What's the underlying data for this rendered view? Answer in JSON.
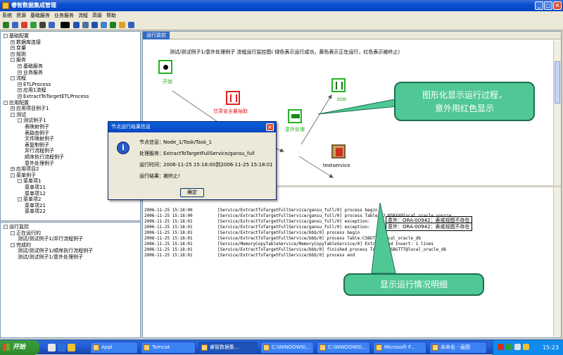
{
  "window": {
    "title": "睿智数据集成管理"
  },
  "menu": [
    "系统",
    "资源",
    "基础服务",
    "业务服务",
    "流程",
    "高级",
    "帮助"
  ],
  "tree_top": [
    {
      "label": "基础配置",
      "level": 0,
      "expander": "-"
    },
    {
      "label": "数据库连接",
      "level": 1,
      "expander": "+"
    },
    {
      "label": "变量",
      "level": 1,
      "expander": "+"
    },
    {
      "label": "规则",
      "level": 1,
      "expander": "+"
    },
    {
      "label": "服务",
      "level": 1,
      "expander": "-"
    },
    {
      "label": "基础服务",
      "level": 2,
      "expander": "+"
    },
    {
      "label": "业务服务",
      "level": 2,
      "expander": "+"
    },
    {
      "label": "流程",
      "level": 1,
      "expander": "-"
    },
    {
      "label": "ETLProcess",
      "level": 2,
      "expander": "+"
    },
    {
      "label": "应用1流程",
      "level": 2,
      "expander": "+"
    },
    {
      "label": "ExtractToTargetETLProcess",
      "level": 2,
      "expander": "+"
    },
    {
      "label": "应用配置",
      "level": 0,
      "expander": "-"
    },
    {
      "label": "应用项目例子1",
      "level": 1,
      "expander": "+"
    },
    {
      "label": "测试",
      "level": 1,
      "expander": "-"
    },
    {
      "label": "测试例子1",
      "level": 2,
      "expander": "-"
    },
    {
      "label": "表映射例子",
      "level": 3,
      "expander": ""
    },
    {
      "label": "表路由例子",
      "level": 3,
      "expander": ""
    },
    {
      "label": "文件映射例子",
      "level": 3,
      "expander": ""
    },
    {
      "label": "表复制例子",
      "level": 3,
      "expander": ""
    },
    {
      "label": "并行流程例子",
      "level": 3,
      "expander": ""
    },
    {
      "label": "顺序执行流程例子",
      "level": 3,
      "expander": ""
    },
    {
      "label": "意外处理例子",
      "level": 3,
      "expander": ""
    },
    {
      "label": "应用项目2",
      "level": 1,
      "expander": "+"
    },
    {
      "label": "菜单例子",
      "level": 1,
      "expander": "-"
    },
    {
      "label": "菜单项1",
      "level": 2,
      "expander": "-"
    },
    {
      "label": "菜单项11",
      "level": 3,
      "expander": ""
    },
    {
      "label": "菜单项12",
      "level": 3,
      "expander": ""
    },
    {
      "label": "菜单项2",
      "level": 2,
      "expander": "-"
    },
    {
      "label": "菜单项21",
      "level": 3,
      "expander": ""
    },
    {
      "label": "菜单项22",
      "level": 3,
      "expander": ""
    }
  ],
  "tree_bottom": [
    {
      "label": "运行监控",
      "level": 0,
      "expander": "-"
    },
    {
      "label": "正在运行的",
      "level": 1,
      "expander": "-"
    },
    {
      "label": "测试/测试例子1/并行流程例子",
      "level": 2,
      "expander": ""
    },
    {
      "label": "完成的",
      "level": 1,
      "expander": "-"
    },
    {
      "label": "测试/测试例子1/顺序执行流程例子",
      "level": 2,
      "expander": ""
    },
    {
      "label": "测试/测试例子1/意外处理例子",
      "level": 2,
      "expander": ""
    }
  ],
  "tab": {
    "label": "运行监控"
  },
  "flow": {
    "title": "测试/测试例子1/意外处理例子 流程运行监控图( 绿色表示运行成功，黄色表示正在运行，红色表示被终止)",
    "nodes": {
      "start": "开始",
      "extract": "甘肃省全量抽取",
      "exception": "意外处理",
      "bbb": "bbb",
      "test": "testservice"
    }
  },
  "log": [
    {
      "ts": "2006-11-25 15:18:00",
      "msg": "[Service/ExtractToTargetFullService/gansu_full/0] process begin"
    },
    {
      "ts": "2006-11-25 15:18:00",
      "msg": "[Service/ExtractToTargetFullService/gansu_full/0] process Table:DJ_NSRXX@local_oracle_source"
    },
    {
      "ts": "2006-11-25 15:18:01",
      "msg": "[Service/ExtractToTargetFullService/gansu_full/0] exception:"
    },
    {
      "ts": "2006-11-25 15:18:01",
      "msg": "[Service/ExtractToTargetFullService/gansu_full/0] exception:"
    },
    {
      "ts": "2006-11-25 15:18:01",
      "msg": "[Service/ExtractToTargetFullService/bbb/0] process begin"
    },
    {
      "ts": "2006-11-25 15:18:01",
      "msg": "[Service/ExtractToTargetFullService/bbb/0] process Table:CSBGTTT@local_oracle_db"
    },
    {
      "ts": "2006-11-25 15:18:01",
      "msg": "[Service/MemoryCopyTableService/MemoryCopyTableService/0] Extract and Insert: 1 lines"
    },
    {
      "ts": "2006-11-25 15:18:01",
      "msg": "[Service/ExtractToTargetFullService/bbb/0] finished process Table: CSBGTTT@local_oracle_db"
    },
    {
      "ts": "2006-11-25 15:18:01",
      "msg": "[Service/ExtractToTargetFullService/bbb/0] process end"
    }
  ],
  "errors": [
    "意外：ORA-00942：表或视图不存在",
    "意外：ORA-00942：表或视图不存在"
  ],
  "callouts": {
    "top": "图形化显示运行过程，\n意外用红色显示",
    "bottom": "显示运行情况明细"
  },
  "dialog": {
    "title": "节点运行结果信息",
    "rows": [
      {
        "k": "节点信息：",
        "v": "Node_1/Task/Task_1"
      },
      {
        "k": "处理服务：",
        "v": "ExtractToTargetFullService/gansu_full"
      },
      {
        "k": "运行时间：",
        "v": "2006-11-25 15:18:00到2006-11-25 15:18:01"
      },
      {
        "k": "运行结果：",
        "v": "被终止!"
      }
    ],
    "ok": "确定"
  },
  "taskbar": {
    "start": "开始",
    "items": [
      "Appl",
      "Tomcat",
      "睿智数据集...",
      "C:\\WINDOWS\\...",
      "C:\\WINDOWS\\...",
      "Microsoft F...",
      "未命名 - 画图"
    ],
    "clock": "15:23"
  },
  "colors": {
    "success": "#22b422",
    "running": "#e0c000",
    "terminated": "#e02020",
    "callout": "#50c896"
  },
  "icons": [
    "app-icon",
    "minimize-icon",
    "maximize-icon",
    "close-icon",
    "info-icon",
    "start-node-icon",
    "service-node-icon"
  ]
}
